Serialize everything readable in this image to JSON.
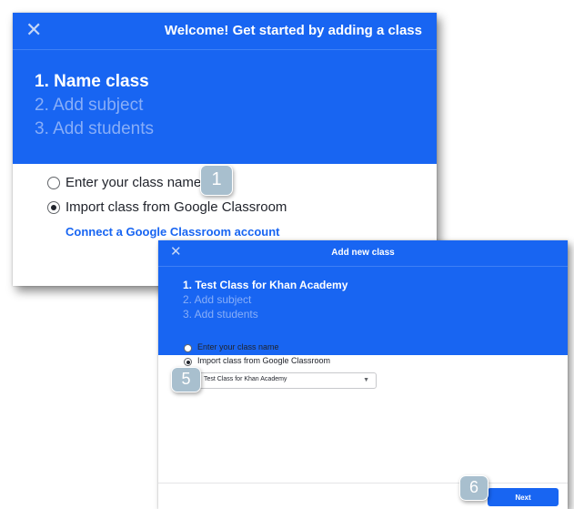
{
  "dialog_welcome": {
    "close_icon": "close-icon",
    "title": "Welcome! Get started by adding a class",
    "steps": [
      "1. Name class",
      "2. Add subject",
      "3. Add students"
    ],
    "options": [
      "Enter your class name",
      "Import class from Google Classroom"
    ],
    "selected_option": 1,
    "link": "Connect a Google Classroom account"
  },
  "dialog_add": {
    "close_icon": "close-icon",
    "title": "Add new class",
    "steps": [
      "1. Test Class for Khan Academy",
      "2. Add subject",
      "3. Add students"
    ],
    "options": [
      "Enter your class name",
      "Import class from Google Classroom"
    ],
    "selected_option": 1,
    "select_value": "Test Class for Khan Academy",
    "next_label": "Next"
  },
  "callouts": [
    "1",
    "5",
    "6"
  ],
  "colors": {
    "brand_blue": "#1865f2",
    "step_inactive": "#88aef8",
    "callout": "#a8bfce"
  }
}
